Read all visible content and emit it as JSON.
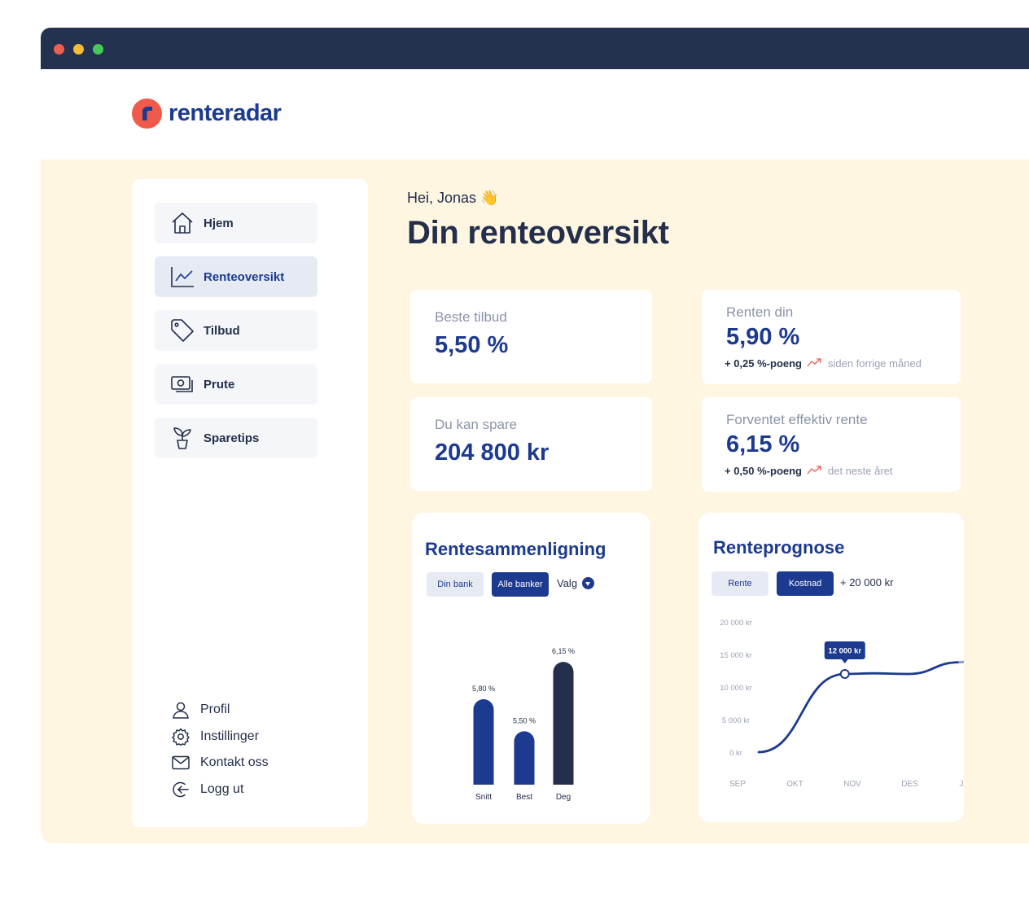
{
  "brand": {
    "name": "renteradar",
    "accent": "#1c3a8f",
    "logo_color": "#f05a4b"
  },
  "sidebar": {
    "items": [
      {
        "label": "Hjem",
        "icon": "home-icon"
      },
      {
        "label": "Renteoversikt",
        "icon": "chart-line-icon",
        "active": true
      },
      {
        "label": "Tilbud",
        "icon": "tag-icon"
      },
      {
        "label": "Prute",
        "icon": "money-icon"
      },
      {
        "label": "Sparetips",
        "icon": "plant-icon"
      }
    ],
    "links": [
      {
        "label": "Profil",
        "icon": "user-icon"
      },
      {
        "label": "Instillinger",
        "icon": "gear-icon"
      },
      {
        "label": "Kontakt oss",
        "icon": "mail-icon"
      },
      {
        "label": "Logg ut",
        "icon": "logout-icon"
      }
    ]
  },
  "main": {
    "greeting": "Hei, Jonas 👋",
    "title": "Din renteoversikt"
  },
  "cards": {
    "best_offer": {
      "label": "Beste tilbud",
      "value": "5,50 %"
    },
    "save": {
      "label": "Du kan spare",
      "value": "204 800 kr"
    },
    "your_rate": {
      "label": "Renten din",
      "value": "5,90 %",
      "delta": "+ 0,25 %-poeng",
      "delta_note": "siden forrige måned"
    },
    "expected": {
      "label": "Forventet effektiv rente",
      "value": "6,15 %",
      "delta": "+ 0,50 %-poeng",
      "delta_note": "det neste året"
    }
  },
  "comparison": {
    "title": "Rentesammenligning",
    "buttons": {
      "own_bank": "Din bank",
      "all_banks": "Alle banker",
      "select": "Valg"
    }
  },
  "forecast": {
    "title": "Renteprognose",
    "buttons": {
      "rate": "Rente",
      "cost": "Kostnad",
      "extra": "+ 20 000 kr"
    },
    "tooltip": "12 000 kr"
  },
  "chart_data": [
    {
      "type": "bar",
      "title": "Rentesammenligning",
      "categories": [
        "Snitt",
        "Best",
        "Deg"
      ],
      "values": [
        5.8,
        5.5,
        6.15
      ],
      "value_labels": [
        "5,80 %",
        "5,50 %",
        "6,15 %"
      ],
      "colors": [
        "#1c3a8f",
        "#1c3a8f",
        "#232f4b"
      ],
      "ylim": [
        5.0,
        6.25
      ],
      "grid": false
    },
    {
      "type": "line",
      "title": "Renteprognose",
      "x": [
        "SEP",
        "OKT",
        "NOV",
        "DES",
        "JAN"
      ],
      "y_ticks": [
        "0 kr",
        "5 000 kr",
        "10 000 kr",
        "15 000 kr",
        "20 000 kr"
      ],
      "ylim": [
        0,
        20000
      ],
      "series": [
        {
          "x": [
            0,
            1.5,
            2,
            2.6,
            3.5
          ],
          "values": [
            0,
            12000,
            12100,
            12000,
            13800
          ],
          "style": "solid"
        },
        {
          "x": [
            3.5,
            4,
            4.45
          ],
          "values": [
            13800,
            16000,
            18500
          ],
          "style": "dashed"
        }
      ],
      "highlight": {
        "x": 1.5,
        "value": 12000,
        "label": "12 000 kr"
      },
      "grid": false
    }
  ]
}
